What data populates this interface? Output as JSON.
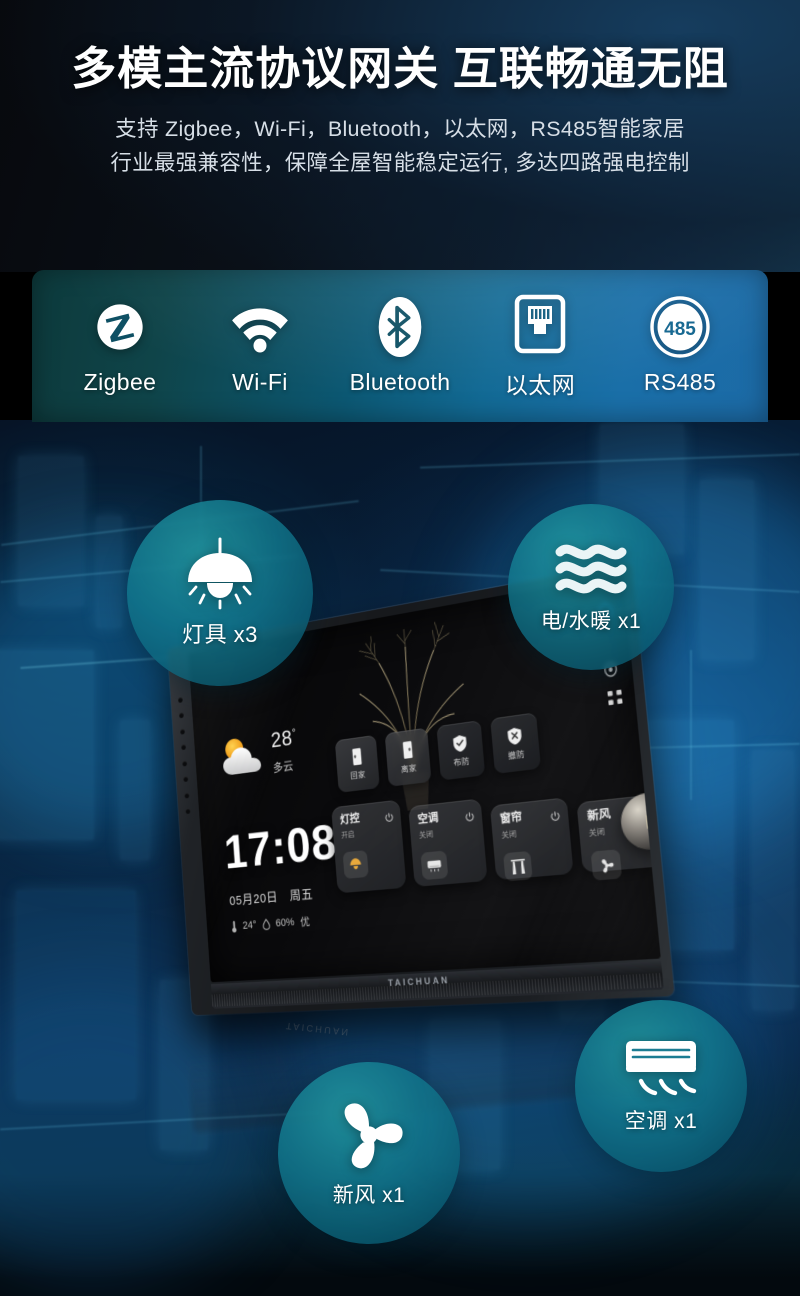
{
  "header": {
    "title": "多模主流协议网关 互联畅通无阻",
    "subtitle_line1": "支持 Zigbee，Wi-Fi，Bluetooth，以太网，RS485智能家居",
    "subtitle_line2": "行业最强兼容性，保障全屋智能稳定运行, 多达四路强电控制"
  },
  "protocols": [
    {
      "label": "Zigbee",
      "icon": "zigbee-icon"
    },
    {
      "label": "Wi-Fi",
      "icon": "wifi-icon"
    },
    {
      "label": "Bluetooth",
      "icon": "bluetooth-icon"
    },
    {
      "label": "以太网",
      "icon": "ethernet-port-icon"
    },
    {
      "label": "RS485",
      "icon": "rs485-icon",
      "badge_text": "485"
    }
  ],
  "badges": [
    {
      "label": "灯具 x3",
      "icon": "pendant-lamp-icon",
      "device": "灯具",
      "count": "x3"
    },
    {
      "label": "电/水暖 x1",
      "icon": "heating-waves-icon",
      "device": "电/水暖",
      "count": "x1"
    },
    {
      "label": "空调 x1",
      "icon": "air-conditioner-icon",
      "device": "空调",
      "count": "x1"
    },
    {
      "label": "新风 x1",
      "icon": "fan-icon",
      "device": "新风",
      "count": "x1"
    }
  ],
  "device": {
    "brand": "TAICHUAN",
    "screen": {
      "weather": {
        "temperature": "28",
        "degree": "°",
        "condition": "多云",
        "icon": "partly-cloudy-icon"
      },
      "clock": "17:08",
      "date": "05月20日",
      "weekday": "周五",
      "env": {
        "temperature": "24°",
        "humidity": "60%",
        "air_quality": "优"
      },
      "scenes": [
        {
          "label": "回家",
          "icon": "door-open-icon"
        },
        {
          "label": "离家",
          "icon": "door-closed-icon"
        },
        {
          "label": "布防",
          "icon": "shield-check-icon"
        },
        {
          "label": "撤防",
          "icon": "shield-off-icon"
        }
      ],
      "cards": [
        {
          "title": "灯控",
          "state": "开启",
          "icon": "lamp-icon"
        },
        {
          "title": "空调",
          "state": "关闭",
          "icon": "ac-unit-icon"
        },
        {
          "title": "窗帘",
          "state": "关闭",
          "icon": "curtain-icon"
        },
        {
          "title": "新风",
          "state": "关闭",
          "icon": "fresh-air-icon"
        }
      ],
      "status_icons": [
        {
          "name": "home-icon"
        },
        {
          "name": "settings-icon"
        }
      ],
      "grid_icon": "apps-grid-icon"
    }
  },
  "colors": {
    "band_left": "#0d3a3c",
    "band_right": "#1c6aa6",
    "badge_teal": "#11768c",
    "header_dark": "#07090d",
    "bg_blue": "#0a2c4e",
    "accent_home": "#2b8fe0",
    "text_white": "#ffffff"
  }
}
